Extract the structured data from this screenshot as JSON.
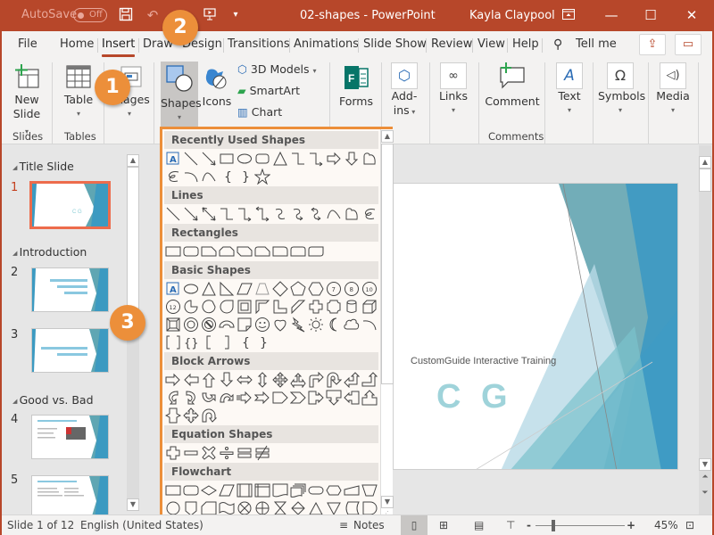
{
  "titlebar": {
    "autosave_label": "AutoSave",
    "autosave_state": "Off",
    "document_title": "02-shapes  -  PowerPoint",
    "user_name": "Kayla Claypool",
    "window_buttons": [
      "ribbon-display-options",
      "minimize",
      "maximize",
      "close"
    ],
    "brand_color": "#b7472a"
  },
  "tabs": [
    {
      "label": "File"
    },
    {
      "label": "Home"
    },
    {
      "label": "Insert",
      "active": true
    },
    {
      "label": "Draw"
    },
    {
      "label": "Design"
    },
    {
      "label": "Transitions"
    },
    {
      "label": "Animations"
    },
    {
      "label": "Slide Show"
    },
    {
      "label": "Review"
    },
    {
      "label": "View"
    },
    {
      "label": "Help"
    }
  ],
  "tell_me": "Tell me",
  "ribbon": {
    "new_slide": "New",
    "new_slide2": "Slide",
    "table": "Table",
    "images": "Images",
    "shapes": "Shapes",
    "icons": "Icons",
    "models3d": "3D Models",
    "smartart": "SmartArt",
    "chart": "Chart",
    "forms": "Forms",
    "addins1": "Add-",
    "addins2": "ins",
    "links": "Links",
    "comment": "Comment",
    "text": "Text",
    "symbols": "Symbols",
    "media": "Media",
    "groups": {
      "slides": "Slides",
      "tables": "Tables",
      "comments": "Comments"
    }
  },
  "gallery": {
    "sections": [
      "Recently Used Shapes",
      "Lines",
      "Rectangles",
      "Basic Shapes",
      "Block Arrows",
      "Equation Shapes",
      "Flowchart"
    ],
    "highlight_color": "#ec8f3a"
  },
  "slides_panel": {
    "sections": [
      "Title Slide",
      "Introduction",
      "Good vs. Bad"
    ],
    "slides": [
      {
        "num": "1",
        "title": "C G",
        "active": true
      },
      {
        "num": "2",
        "title": "What Do You Want To Know After Today's Presentation?"
      },
      {
        "num": "3",
        "title": "What kind of presentations are you giving?"
      },
      {
        "num": "4",
        "title": "What Makes a Bad Presentation?"
      },
      {
        "num": "5",
        "title": "What Makes a Presentation Good?"
      }
    ]
  },
  "slide": {
    "subtitle": "CustomGuide Interactive Training",
    "logo": "C G"
  },
  "callouts": [
    "1",
    "2",
    "3"
  ],
  "statusbar": {
    "slide_info": "Slide 1 of 12",
    "language": "English (United States)",
    "notes": "Notes",
    "zoom": "45%"
  }
}
